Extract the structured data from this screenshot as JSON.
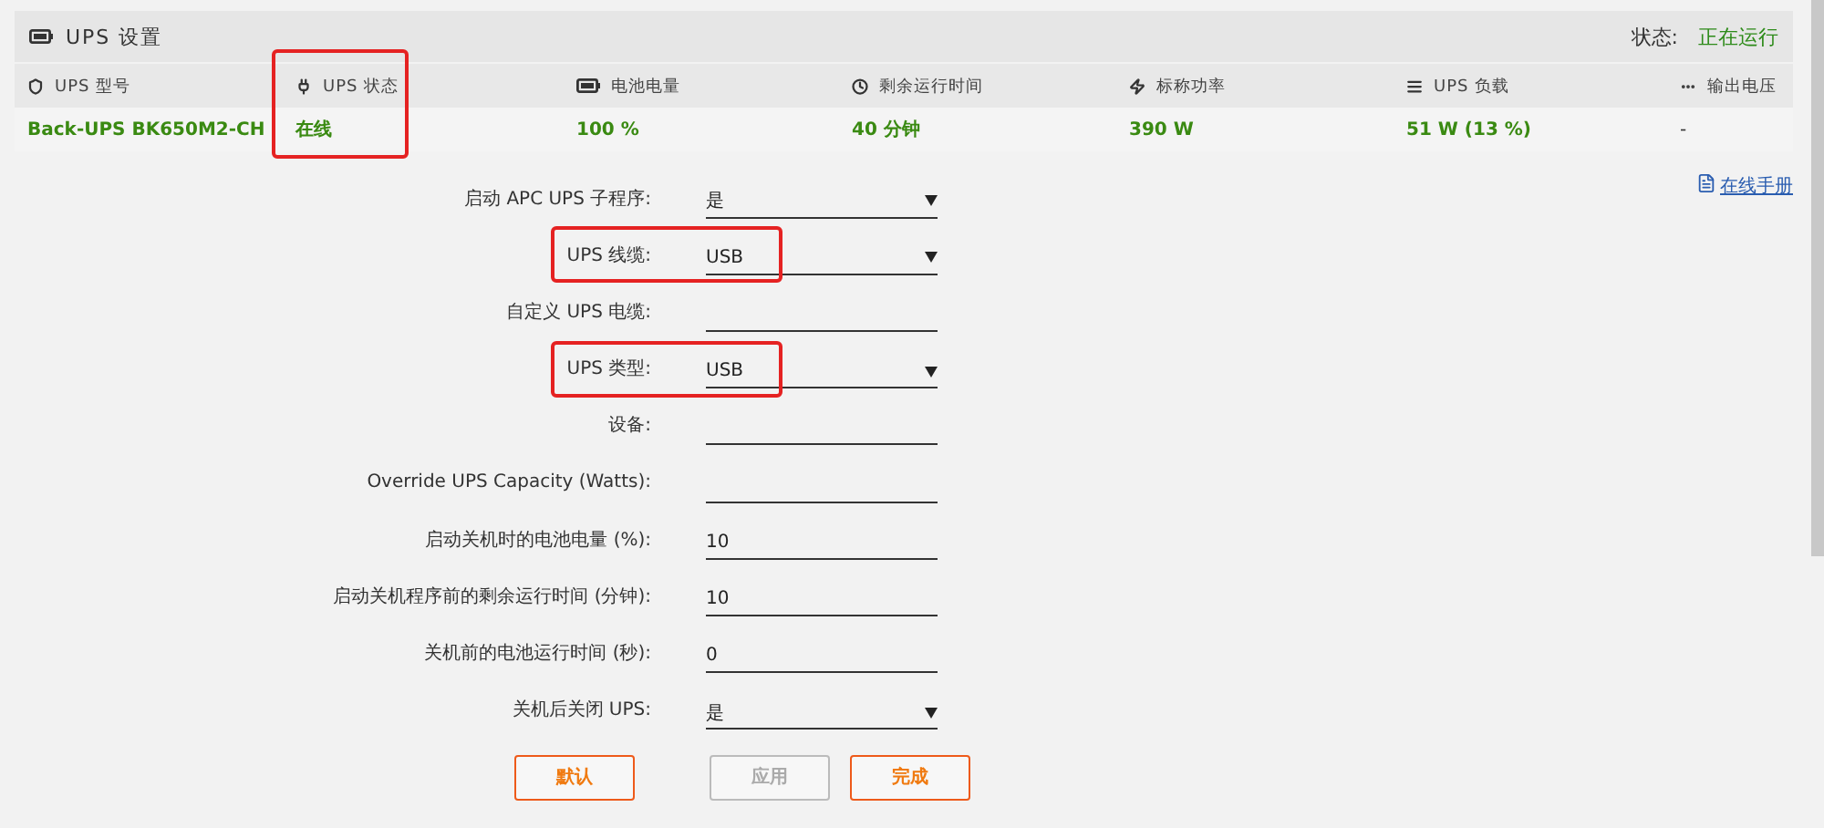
{
  "panel": {
    "title": "UPS 设置",
    "status_label": "状态:",
    "status_value": "正在运行"
  },
  "table": {
    "columns": [
      {
        "label": "UPS 型号",
        "value": "Back-UPS BK650M2-CH",
        "highlighted": false
      },
      {
        "label": "UPS 状态",
        "value": "在线",
        "highlighted": true
      },
      {
        "label": "电池电量",
        "value": "100 %",
        "highlighted": false
      },
      {
        "label": "剩余运行时间",
        "value": "40 分钟",
        "highlighted": false
      },
      {
        "label": "标称功率",
        "value": "390 W",
        "highlighted": false
      },
      {
        "label": "UPS 负载",
        "value": "51 W (13 %)",
        "highlighted": false
      },
      {
        "label": "输出电压",
        "value": "-",
        "highlighted": false
      }
    ]
  },
  "manual_link": "在线手册",
  "form": [
    {
      "kind": "select",
      "label": "启动 APC UPS 子程序:",
      "value": "是",
      "highlighted": false
    },
    {
      "kind": "select",
      "label": "UPS 线缆:",
      "value": "USB",
      "highlighted": true
    },
    {
      "kind": "text",
      "label": "自定义 UPS 电缆:",
      "highlighted": false
    },
    {
      "kind": "select",
      "label": "UPS 类型:",
      "value": "USB",
      "highlighted": true
    },
    {
      "kind": "text",
      "label": "设备:",
      "highlighted": false
    },
    {
      "kind": "text",
      "label": "Override UPS Capacity (Watts):",
      "highlighted": false
    },
    {
      "kind": "text",
      "label": "启动关机时的电池电量 (%):",
      "value": "10",
      "highlighted": false
    },
    {
      "kind": "text",
      "label": "启动关机程序前的剩余运行时间 (分钟):",
      "value": "10",
      "highlighted": false
    },
    {
      "kind": "text",
      "label": "关机前的电池运行时间 (秒):",
      "value": "0",
      "highlighted": false
    },
    {
      "kind": "select",
      "label": "关机后关闭 UPS:",
      "value": "是",
      "highlighted": false
    }
  ],
  "buttons": [
    {
      "label": "默认",
      "disabled": false
    },
    {
      "label": "应用",
      "disabled": true
    },
    {
      "label": "完成",
      "disabled": false
    }
  ]
}
